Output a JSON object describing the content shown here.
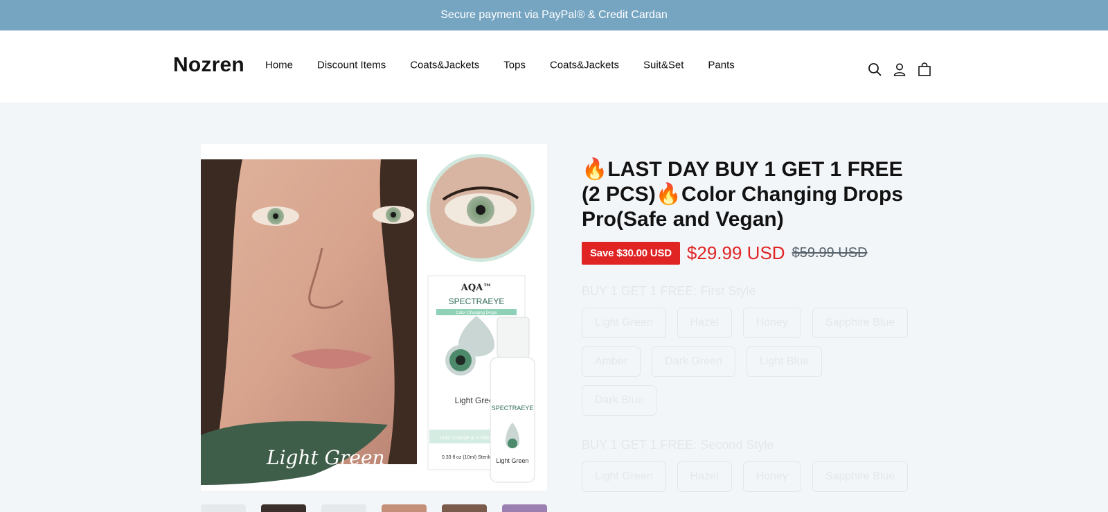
{
  "announcement": "Secure payment via PayPal® & Credit Cardan",
  "header": {
    "logo": "Nozren",
    "nav": [
      "Home",
      "Discount Items",
      "Coats&Jackets",
      "Tops",
      "Coats&Jackets",
      "Suit&Set",
      "Pants"
    ],
    "icons": [
      "search-icon",
      "account-icon",
      "cart-icon"
    ]
  },
  "product": {
    "title": "🔥LAST DAY BUY 1 GET 1 FREE (2 PCS)🔥Color Changing Drops Pro(Safe and Vegan)",
    "save_badge": "Save $30.00 USD",
    "price": "$29.99 USD",
    "compare_price": "$59.99 USD",
    "image": {
      "brand": "AQA™",
      "product_name": "SPECTRAEYE",
      "box_subtitle": "Color Changing Drops",
      "variant_label": "Light Green",
      "box_tagline": "Color Change at a Glance",
      "volume": "0.33 fl oz (10ml) Sterile",
      "script_caption": "Light Green"
    },
    "first_style": {
      "label": "BUY 1 GET 1 FREE: First Style",
      "options": [
        "Light Green",
        "Hazel",
        "Honey",
        "Sapphire Blue",
        "Amber",
        "Dark Green",
        "Light Blue",
        "Dark Blue"
      ]
    },
    "second_style": {
      "label": "BUY 1 GET 1 FREE: Second Style",
      "options": [
        "Light Green",
        "Hazel",
        "Honey",
        "Sapphire Blue"
      ]
    }
  },
  "colors": {
    "announcement_bg": "#76a5c2",
    "page_bg": "#f3f6f9",
    "sale_red": "#e02424"
  }
}
